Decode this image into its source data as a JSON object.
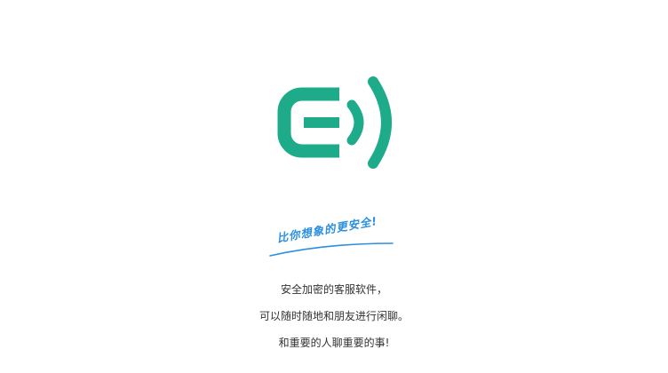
{
  "brand": {
    "logo_icon": "chat-signal-logo-icon",
    "accent_color": "#1eab8a",
    "slogan": "比你想象的更安全!",
    "slogan_color": "#2a8fe0"
  },
  "description": {
    "line1": "安全加密的客服软件，",
    "line2": "可以随时随地和朋友进行闲聊。",
    "line3": "和重要的人聊重要的事!"
  }
}
